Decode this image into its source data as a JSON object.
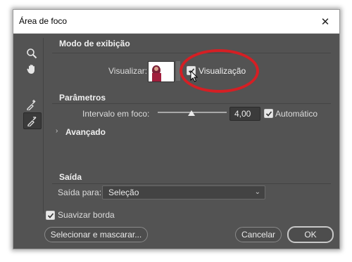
{
  "window": {
    "title": "Área de foco",
    "close_glyph": "✕"
  },
  "tools": {
    "zoom_icon": "zoom-icon",
    "hand_icon": "hand-icon",
    "add_brush_icon": "focus-area-add-icon",
    "subtract_brush_icon": "focus-area-subtract-icon"
  },
  "view_mode": {
    "heading": "Modo de exibição",
    "view_label": "Visualizar:",
    "preview_label": "Visualização",
    "preview_checked": true
  },
  "parameters": {
    "heading": "Parâmetros",
    "range_label": "Intervalo em foco:",
    "range_value": "4,00",
    "slider_level": 0.45,
    "auto_label": "Automático",
    "auto_checked": true,
    "advanced_label": "Avançado"
  },
  "output": {
    "heading": "Saída",
    "output_to_label": "Saída para:",
    "output_to_value": "Seleção"
  },
  "footer": {
    "soften_label": "Suavizar borda",
    "soften_checked": true,
    "select_mask_button": "Selecionar e mascarar...",
    "cancel_button": "Cancelar",
    "ok_button": "OK"
  },
  "colors": {
    "annotation_circle": "#d51f24",
    "dialog_bg": "#535353"
  }
}
